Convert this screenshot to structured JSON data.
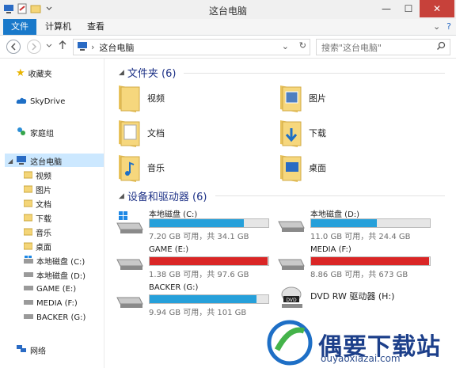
{
  "window": {
    "title": "这台电脑",
    "controls": [
      "—",
      "☐",
      "✕"
    ]
  },
  "ribbon": {
    "tabs": [
      "文件",
      "计算机",
      "查看"
    ]
  },
  "address": {
    "path": "这台电脑",
    "search_placeholder": "搜索\"这台电脑\""
  },
  "nav": {
    "favorites": "收藏夹",
    "skydrive": "SkyDrive",
    "homegroup": "家庭组",
    "this_pc": "这台电脑",
    "children": [
      "视频",
      "图片",
      "文档",
      "下载",
      "音乐",
      "桌面",
      "本地磁盘 (C:)",
      "本地磁盘 (D:)",
      "GAME (E:)",
      "MEDIA (F:)",
      "BACKER (G:)"
    ],
    "network": "网络"
  },
  "folders_group": "文件夹 (6)",
  "folders": [
    "视频",
    "图片",
    "文档",
    "下载",
    "音乐",
    "桌面"
  ],
  "devices_group": "设备和驱动器 (6)",
  "drives": [
    {
      "name": "本地磁盘 (C:)",
      "space": "7.20 GB 可用，共 34.1 GB",
      "used_fraction": 0.79,
      "color": "#26a0da"
    },
    {
      "name": "本地磁盘 (D:)",
      "space": "11.0 GB 可用，共 24.4 GB",
      "used_fraction": 0.55,
      "color": "#26a0da"
    },
    {
      "name": "GAME (E:)",
      "space": "1.38 GB 可用，共 97.6 GB",
      "used_fraction": 0.99,
      "color": "#da2626"
    },
    {
      "name": "MEDIA (F:)",
      "space": "8.86 GB 可用，共 673 GB",
      "used_fraction": 0.99,
      "color": "#da2626"
    },
    {
      "name": "BACKER (G:)",
      "space": "9.94 GB 可用，共 101 GB",
      "used_fraction": 0.9,
      "color": "#26a0da"
    }
  ],
  "dvd": {
    "name": "DVD RW 驱动器 (H:)",
    "badge": "DVD"
  },
  "watermark": {
    "text": "偶要下载站",
    "url": "ouyaoxiazai.com"
  }
}
